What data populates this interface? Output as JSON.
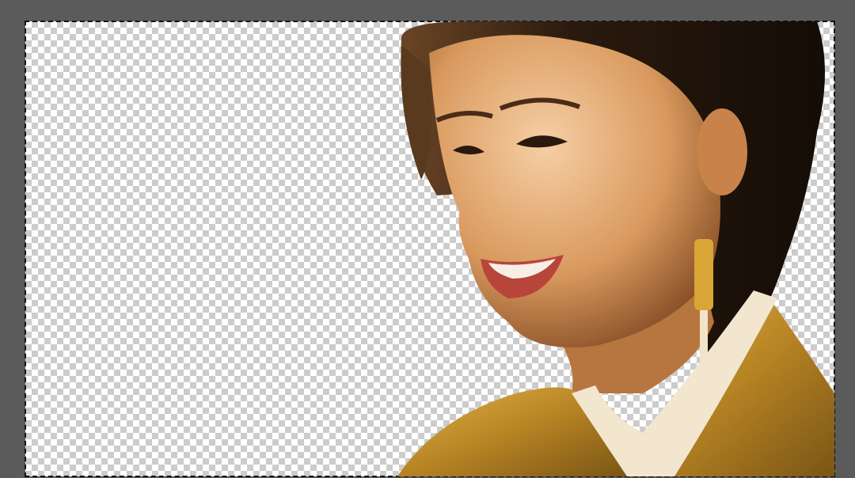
{
  "editor": {
    "canvas": {
      "layer_content": "cutout-portrait",
      "selection_active": true,
      "colors": {
        "workspace": "#5b5b5b",
        "checker_light": "#ffffff",
        "checker_dark": "#cccccc",
        "robe": "#c99a2e",
        "collar": "#f2e6cf",
        "hair": "#1e140c",
        "skin": "#e2a877"
      }
    }
  }
}
